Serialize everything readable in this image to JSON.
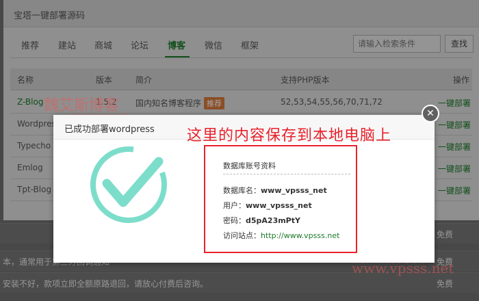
{
  "panel": {
    "title": "宝塔一键部署源码",
    "tabs": [
      {
        "label": "推荐"
      },
      {
        "label": "建站"
      },
      {
        "label": "商城"
      },
      {
        "label": "论坛"
      },
      {
        "label": "博客",
        "active": true
      },
      {
        "label": "微信"
      },
      {
        "label": "框架"
      }
    ],
    "search_placeholder": "请输入检索条件",
    "search_button": "查找"
  },
  "table": {
    "headers": [
      "名称",
      "版本",
      "简介",
      "支持PHP版本",
      "操作"
    ],
    "rows": [
      {
        "name": "Z-Blog",
        "version": "1.5.2",
        "desc": "国内知名博客程序",
        "badge": "推荐",
        "php": "52,53,54,55,56,70,71,72",
        "op": "一键部署"
      },
      {
        "name": "Wordpress",
        "op": "一键部署"
      },
      {
        "name": "Typecho",
        "op": "一键部署"
      },
      {
        "name": "Emlog",
        "op": "一键部署"
      },
      {
        "name": "Tpt-Blog",
        "op": "一键部署"
      }
    ]
  },
  "background_rows": [
    {
      "text": "",
      "right": "免费"
    },
    {
      "text": "本，通常用于第三方回调通知",
      "right": "免费"
    },
    {
      "text": "安装不好，款项立即全额原路退回，请放心付费后咨询。",
      "right": "免费"
    }
  ],
  "watermarks": [
    "魏艾斯博客",
    "www.vpsss.net"
  ],
  "modal": {
    "title": "已成功部署wordpress",
    "close_label": "✕",
    "info": {
      "title": "数据库账号资料",
      "db_name_label": "数据库名：",
      "db_name_value": "www_vpsss_net",
      "user_label": "用户：",
      "user_value": "www_vpsss_net",
      "password_label": "密码：",
      "password_value": "d5pA23mPtY",
      "site_label": "访问站点：",
      "site_value": "http://www.vpsss.net"
    }
  },
  "annotation": "这里的内容保存到本地电脑上",
  "colors": {
    "accent_green": "#1c7a2a",
    "check_teal": "#7dddcb",
    "annotation_red": "#e8212b",
    "badge_orange": "#d4793a"
  }
}
